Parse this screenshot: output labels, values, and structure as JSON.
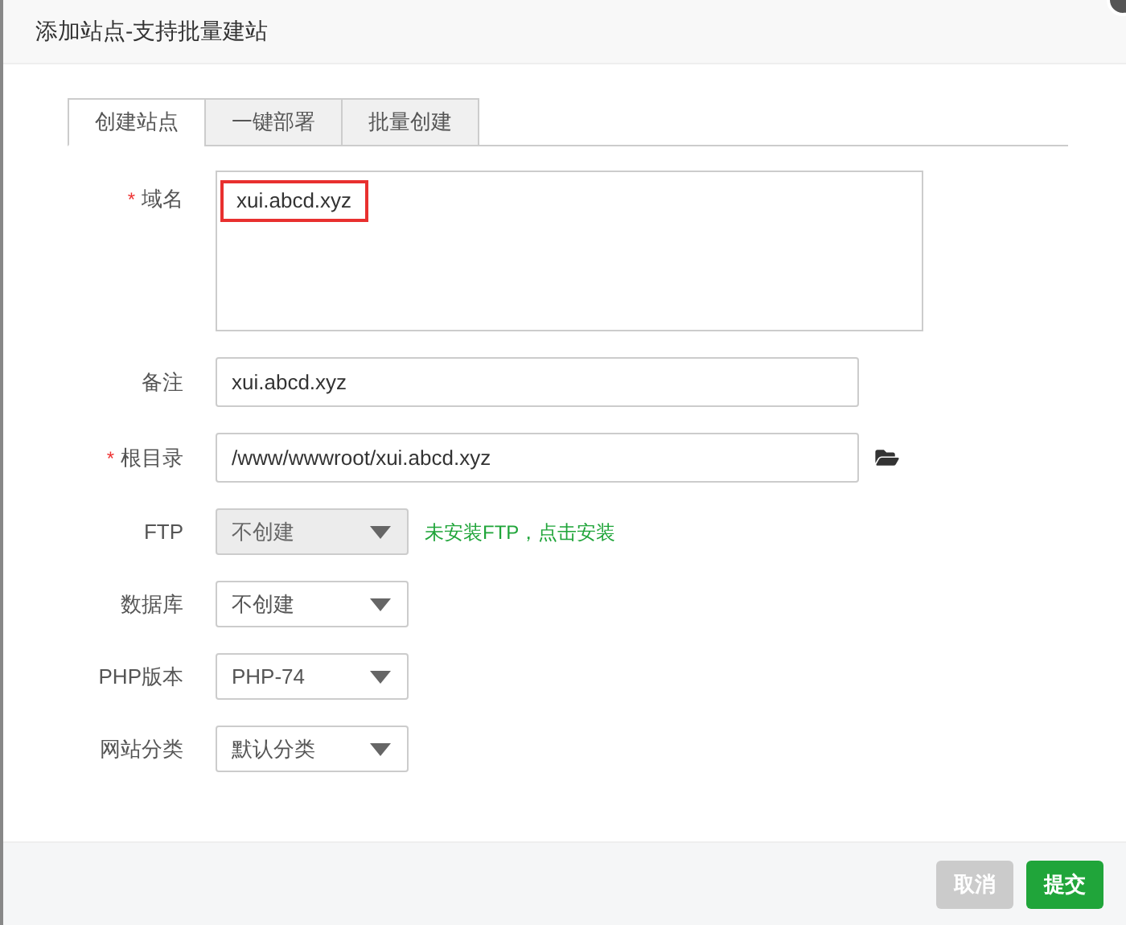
{
  "dialog": {
    "title": "添加站点-支持批量建站"
  },
  "tabs": [
    {
      "label": "创建站点",
      "selected": true
    },
    {
      "label": "一键部署",
      "selected": false
    },
    {
      "label": "批量创建",
      "selected": false
    }
  ],
  "fields": [
    {
      "kind": "textarea",
      "required_mark": "*",
      "label": "域名",
      "value": "xui.abcd.xyz",
      "highlighted": true
    },
    {
      "kind": "input",
      "label": "备注",
      "value": "xui.abcd.xyz"
    },
    {
      "kind": "input",
      "required_mark": "*",
      "label": "根目录",
      "value": "/www/wwwroot/xui.abcd.xyz",
      "browse": true
    },
    {
      "kind": "select",
      "label": "FTP",
      "value": "不创建",
      "disabled": true,
      "hint": "未安装FTP，点击安装"
    },
    {
      "kind": "select",
      "label": "数据库",
      "value": "不创建",
      "disabled": false
    },
    {
      "kind": "select",
      "label": "PHP版本",
      "value": "PHP-74",
      "disabled": false
    },
    {
      "kind": "select",
      "label": "网站分类",
      "value": "默认分类",
      "disabled": false
    }
  ],
  "buttons": [
    {
      "label": "取消",
      "kind": "secondary"
    },
    {
      "label": "提交",
      "kind": "primary"
    }
  ]
}
